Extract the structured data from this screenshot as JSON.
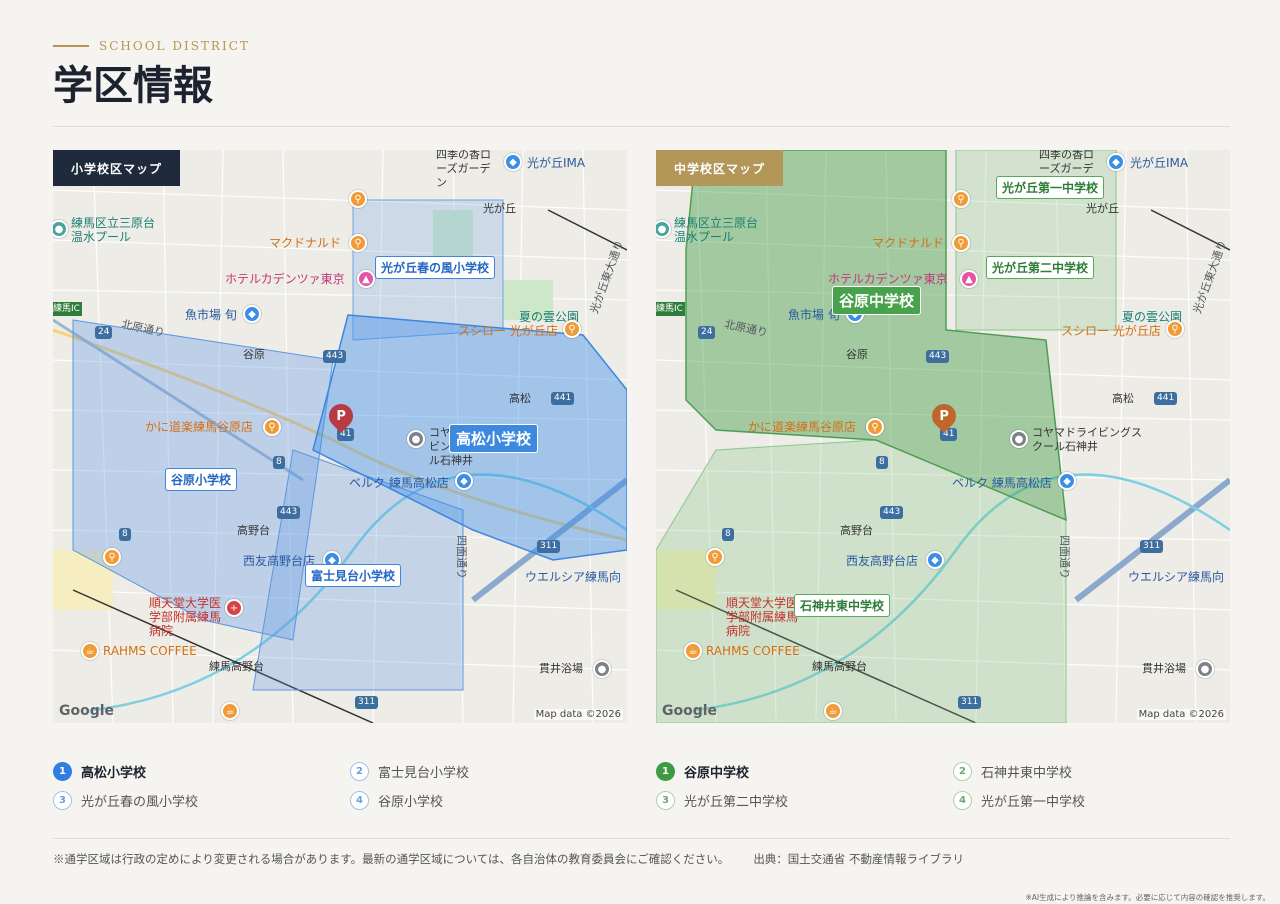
{
  "header": {
    "eyebrow": "SCHOOL DISTRICT",
    "title": "学区情報"
  },
  "maps": {
    "elementary": {
      "tag": "小学校区マップ",
      "labels": {
        "main": "高松小学校",
        "a": "光が丘春の風小学校",
        "b": "谷原小学校",
        "c": "富士見台小学校"
      }
    },
    "junior": {
      "tag": "中学校区マップ",
      "labels": {
        "main": "谷原中学校",
        "a": "光が丘第一中学校",
        "b": "光が丘第二中学校",
        "c": "石神井東中学校"
      }
    },
    "pois": {
      "kaorose": "四季の香ローズガーデン",
      "ima": "光が丘IMA",
      "hikarigaoka": "光が丘",
      "pool": "練馬区立三原台温水プール",
      "mcd": "マクドナルド",
      "hotel": "ホテルカデンツァ東京",
      "uoichi": "魚市場 旬",
      "natsunokumo": "夏の雲公園",
      "sushiro": "スシロー 光が丘店",
      "kitahara": "北原通り",
      "yahara": "谷原",
      "takamatsu": "高松",
      "kanidoraku": "かに道楽練馬谷原店",
      "koyamada": "コヤマドライビングスクール石神井",
      "berc": "ベルク 練馬高松店",
      "takanodai": "高野台",
      "seiyu": "西友高野台店",
      "welcia": "ウエルシア練馬向",
      "juntendo": "順天堂大学医学部附属練馬病院",
      "rahms": "RAHMS COFFEE",
      "nerimatakanodai": "練馬高野台",
      "nukui": "貫井浴場",
      "hikarigaoka_east": "光が丘東大通り",
      "yotsumen": "四面通り",
      "nerima_ic": "練馬IC",
      "parking": "P",
      "route24": "24",
      "route443": "443",
      "route441": "441",
      "route311": "311",
      "route8": "8",
      "route41": "41"
    },
    "credits": {
      "google": "Google",
      "mapdata": "Map data ©2026"
    }
  },
  "lists": {
    "elementary": [
      {
        "num": "1",
        "name": "高松小学校"
      },
      {
        "num": "2",
        "name": "富士見台小学校"
      },
      {
        "num": "3",
        "name": "光が丘春の風小学校"
      },
      {
        "num": "4",
        "name": "谷原小学校"
      }
    ],
    "junior": [
      {
        "num": "1",
        "name": "谷原中学校"
      },
      {
        "num": "2",
        "name": "石神井東中学校"
      },
      {
        "num": "3",
        "name": "光が丘第二中学校"
      },
      {
        "num": "4",
        "name": "光が丘第一中学校"
      }
    ]
  },
  "footer": {
    "note": "※通学区域は行政の定めにより変更される場合があります。最新の通学区域については、各自治体の教育委員会にご確認ください。",
    "source": "出典：国土交通省 不動産情報ライブラリ",
    "disclaimer": "※AI生成により推論を含みます。必要に応じて内容の確認を推奨します。"
  }
}
